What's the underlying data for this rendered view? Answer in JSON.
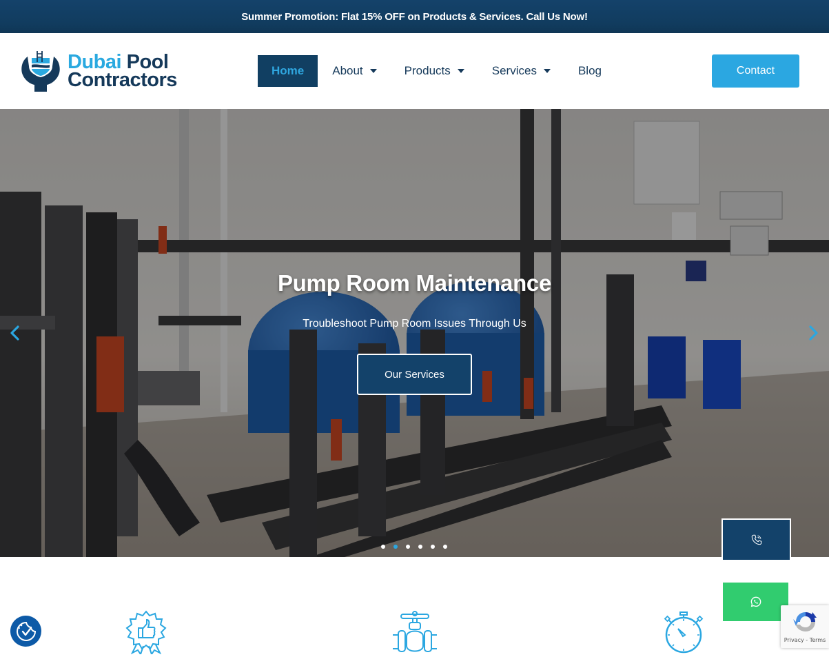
{
  "promo_bar": {
    "text": "Summer Promotion: Flat 15% OFF on Products & Services. Call Us Now!"
  },
  "header": {
    "logo": {
      "line1_part1": "Dubai",
      "line1_part2": "Pool",
      "line2": "Contractors",
      "icon": "pool-wrench-logo-icon"
    },
    "nav": [
      {
        "label": "Home",
        "active": true,
        "has_dropdown": false
      },
      {
        "label": "About",
        "active": false,
        "has_dropdown": true
      },
      {
        "label": "Products",
        "active": false,
        "has_dropdown": true
      },
      {
        "label": "Services",
        "active": false,
        "has_dropdown": true
      },
      {
        "label": "Blog",
        "active": false,
        "has_dropdown": false
      }
    ],
    "contact_button": "Contact"
  },
  "hero": {
    "title": "Pump Room Maintenance",
    "subtitle": "Troubleshoot Pump Room Issues Through Us",
    "button": "Our Services",
    "prev_icon": "chevron-left-icon",
    "next_icon": "chevron-right-icon",
    "slide_count": 6,
    "active_slide": 2
  },
  "floating": {
    "call_icon": "phone-icon",
    "whatsapp_icon": "whatsapp-icon",
    "cookie_icon": "cookie-consent-icon",
    "recaptcha_text": "Privacy - Terms"
  },
  "features": [
    {
      "icon": "thumbs-up-badge-icon"
    },
    {
      "icon": "pipe-valve-icon"
    },
    {
      "icon": "stopwatch-icon"
    }
  ],
  "colors": {
    "brand_dark": "#13426a",
    "brand_light": "#2ba7e1",
    "whatsapp": "#31cc6f"
  }
}
